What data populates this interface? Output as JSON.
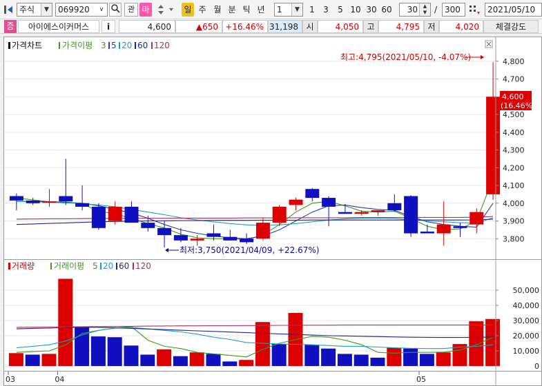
{
  "toolbar": {
    "market_label": "주식",
    "stock_code": "069920",
    "search_icon": "magnifier-icon",
    "kwan_label": "관",
    "ma_label": "마",
    "period_buttons": [
      "일",
      "주",
      "월",
      "분",
      "틱",
      "년"
    ],
    "period_active": "일",
    "interval_value": "1",
    "quick_intervals": [
      "1",
      "3",
      "5",
      "10",
      "30",
      "60"
    ],
    "display_count": "30",
    "total_count": "300",
    "date_value": "2021/05/10",
    "colors": {
      "active_day": "#f0c020",
      "ma_button": "#ff55aa",
      "jeung_badge": "#e0508c"
    }
  },
  "stock_info": {
    "badge": "증",
    "name": "아이에스이커머스",
    "info_button": "i",
    "price": "4,600",
    "change": "▲650",
    "change_pct": "+16.46%",
    "volume": "31,198",
    "open_label": "시",
    "open": "4,050",
    "high_label": "고",
    "high": "4,795",
    "low_label": "저",
    "low": "4,020",
    "strength_label": "체결강도"
  },
  "price_pane": {
    "title": "가격차트",
    "ma_title": "가격이평",
    "ma_periods": [
      "3",
      "5",
      "20",
      "60",
      "120"
    ],
    "ma_colors": [
      "#3a9a1a",
      "#2a3aaa",
      "#1aa0c0",
      "#222288",
      "#b03050"
    ],
    "high_annotation": "최고:4,795(2021/05/10, -4.07%)",
    "low_annotation": "최저:3,750(2021/04/09, +22.67%)",
    "last_price_tag": "4,600",
    "last_change_tag": "(16.46%)"
  },
  "volume_pane": {
    "title": "거래량",
    "ma_title": "거래이평",
    "ma_periods": [
      "5",
      "20",
      "60",
      "120"
    ],
    "ma_colors": [
      "#3a9a1a",
      "#1aa0c0",
      "#222288",
      "#b03050"
    ]
  },
  "x_axis_labels": [
    {
      "label": "03",
      "index": 0
    },
    {
      "label": "04",
      "index": 3
    },
    {
      "label": "05",
      "index": 25
    }
  ],
  "chart_data": [
    {
      "type": "candlestick",
      "title": "",
      "ylim": [
        3700,
        4850
      ],
      "yticks": [
        3800,
        3900,
        4000,
        4100,
        4200,
        4300,
        4400,
        4500,
        4600,
        4700,
        4800
      ],
      "ytick_labels": [
        "3,800",
        "3,900",
        "4,000",
        "4,100",
        "4,200",
        "4,300",
        "4,400",
        "4,500",
        "4,600",
        "4,700",
        "4,800"
      ],
      "colors": {
        "up": "#dd0000",
        "down": "#1010c0"
      },
      "candles": [
        {
          "o": 4040,
          "h": 4055,
          "l": 3960,
          "c": 4015
        },
        {
          "o": 4015,
          "h": 4030,
          "l": 3990,
          "c": 4000
        },
        {
          "o": 4010,
          "h": 4080,
          "l": 3980,
          "c": 4010
        },
        {
          "o": 4040,
          "h": 4250,
          "l": 3990,
          "c": 4010
        },
        {
          "o": 4000,
          "h": 4100,
          "l": 3960,
          "c": 3980
        },
        {
          "o": 3980,
          "h": 4000,
          "l": 3850,
          "c": 3860
        },
        {
          "o": 3900,
          "h": 4010,
          "l": 3880,
          "c": 3980
        },
        {
          "o": 3980,
          "h": 4010,
          "l": 3890,
          "c": 3890
        },
        {
          "o": 3890,
          "h": 3930,
          "l": 3840,
          "c": 3860
        },
        {
          "o": 3860,
          "h": 3900,
          "l": 3750,
          "c": 3820
        },
        {
          "o": 3820,
          "h": 3860,
          "l": 3780,
          "c": 3790
        },
        {
          "o": 3790,
          "h": 3820,
          "l": 3760,
          "c": 3800
        },
        {
          "o": 3830,
          "h": 3880,
          "l": 3790,
          "c": 3810
        },
        {
          "o": 3810,
          "h": 3850,
          "l": 3790,
          "c": 3790
        },
        {
          "o": 3800,
          "h": 3830,
          "l": 3770,
          "c": 3780
        },
        {
          "o": 3800,
          "h": 3920,
          "l": 3790,
          "c": 3890
        },
        {
          "o": 3890,
          "h": 3990,
          "l": 3870,
          "c": 3980
        },
        {
          "o": 3990,
          "h": 4030,
          "l": 3960,
          "c": 4020
        },
        {
          "o": 4080,
          "h": 4085,
          "l": 4010,
          "c": 4030
        },
        {
          "o": 4030,
          "h": 4040,
          "l": 3870,
          "c": 3980
        },
        {
          "o": 3950,
          "h": 3995,
          "l": 3940,
          "c": 3940
        },
        {
          "o": 3940,
          "h": 3960,
          "l": 3930,
          "c": 3950
        },
        {
          "o": 3950,
          "h": 3960,
          "l": 3930,
          "c": 3960
        },
        {
          "o": 4000,
          "h": 4050,
          "l": 3950,
          "c": 3960
        },
        {
          "o": 4040,
          "h": 4045,
          "l": 3810,
          "c": 3830
        },
        {
          "o": 3840,
          "h": 3880,
          "l": 3830,
          "c": 3830
        },
        {
          "o": 3830,
          "h": 4010,
          "l": 3760,
          "c": 3880
        },
        {
          "o": 3870,
          "h": 3890,
          "l": 3810,
          "c": 3860
        },
        {
          "o": 3880,
          "h": 3970,
          "l": 3830,
          "c": 3950
        },
        {
          "o": 4050,
          "h": 4795,
          "l": 4020,
          "c": 4600
        }
      ],
      "ma_lines": {
        "3": [
          4030,
          4018,
          4008,
          4006,
          3996,
          3955,
          3940,
          3915,
          3885,
          3860,
          3825,
          3805,
          3800,
          3800,
          3795,
          3820,
          3880,
          3950,
          4000,
          4010,
          3985,
          3955,
          3950,
          3955,
          3915,
          3870,
          3850,
          3855,
          3900,
          4140
        ],
        "5": [
          4010,
          4010,
          4008,
          4005,
          4000,
          3985,
          3965,
          3945,
          3915,
          3880,
          3850,
          3830,
          3815,
          3805,
          3800,
          3815,
          3850,
          3900,
          3950,
          3985,
          3990,
          3975,
          3965,
          3960,
          3925,
          3895,
          3880,
          3870,
          3865,
          4000
        ],
        "20": [
          4010,
          4008,
          4005,
          4002,
          3998,
          3990,
          3980,
          3965,
          3950,
          3935,
          3918,
          3905,
          3895,
          3885,
          3878,
          3875,
          3878,
          3885,
          3895,
          3905,
          3912,
          3915,
          3915,
          3914,
          3908,
          3900,
          3895,
          3890,
          3888,
          3918
        ],
        "60": [
          3880,
          3883,
          3886,
          3889,
          3892,
          3895,
          3897,
          3899,
          3900,
          3901,
          3902,
          3902,
          3903,
          3903,
          3903,
          3904,
          3904,
          3904,
          3905,
          3905,
          3905,
          3905,
          3905,
          3905,
          3905,
          3905,
          3905,
          3905,
          3906,
          3910
        ],
        "120": [
          3910,
          3911,
          3912,
          3912,
          3913,
          3914,
          3914,
          3915,
          3915,
          3915,
          3916,
          3916,
          3916,
          3916,
          3917,
          3917,
          3917,
          3918,
          3918,
          3918,
          3918,
          3919,
          3919,
          3919,
          3920,
          3920,
          3920,
          3920,
          3921,
          3925
        ]
      }
    },
    {
      "type": "bar",
      "title": "",
      "ylim": [
        0,
        60000
      ],
      "yticks": [
        0,
        10000,
        20000,
        30000,
        40000,
        50000
      ],
      "ytick_labels": [
        "0",
        "10,000",
        "20,000",
        "30,000",
        "40,000",
        "50,000"
      ],
      "values": [
        8500,
        7500,
        8000,
        57500,
        25500,
        19500,
        19000,
        13500,
        7500,
        11000,
        6500,
        9000,
        8000,
        3000,
        4000,
        29000,
        14500,
        35000,
        14000,
        11500,
        8000,
        7500,
        5500,
        12000,
        11500,
        8000,
        9000,
        14500,
        29500,
        31000
      ],
      "up": [
        true,
        false,
        true,
        true,
        false,
        false,
        false,
        false,
        false,
        true,
        false,
        true,
        false,
        false,
        true,
        true,
        false,
        true,
        false,
        false,
        false,
        false,
        false,
        true,
        false,
        false,
        true,
        true,
        true,
        true
      ],
      "ma_lines": {
        "5": [
          9000,
          9500,
          10000,
          14000,
          21500,
          23500,
          25000,
          26000,
          17000,
          13000,
          11500,
          9000,
          8000,
          7000,
          6000,
          11000,
          15000,
          17500,
          19500,
          19000,
          17000,
          14000,
          9000,
          8500,
          9000,
          9000,
          9200,
          10500,
          14000,
          19000
        ],
        "20": [
          12000,
          13000,
          14000,
          16500,
          20500,
          23500,
          25000,
          25500,
          24500,
          23500,
          22500,
          21000,
          19000,
          17500,
          15500,
          15000,
          14500,
          14300,
          14000,
          13500,
          13000,
          13000,
          12500,
          12000,
          11700,
          11500,
          11500,
          12500,
          13000,
          14000
        ],
        "60": [
          24500,
          24800,
          25000,
          25300,
          25600,
          25500,
          25200,
          24800,
          24400,
          24000,
          23600,
          23200,
          22800,
          22400,
          22000,
          21600,
          21200,
          20800,
          20400,
          20000,
          19800,
          19600,
          19400,
          19200,
          19000,
          18900,
          18800,
          18800,
          18900,
          19200
        ],
        "120": [
          25500,
          25600,
          25700,
          25800,
          25900,
          26000,
          26100,
          26200,
          26300,
          26400,
          26500,
          26500,
          26600,
          26600,
          26700,
          26700,
          26800,
          26800,
          26900,
          26900,
          27000,
          27000,
          27000,
          27000,
          27000,
          27000,
          27000,
          27000,
          27000,
          27100
        ]
      }
    }
  ]
}
